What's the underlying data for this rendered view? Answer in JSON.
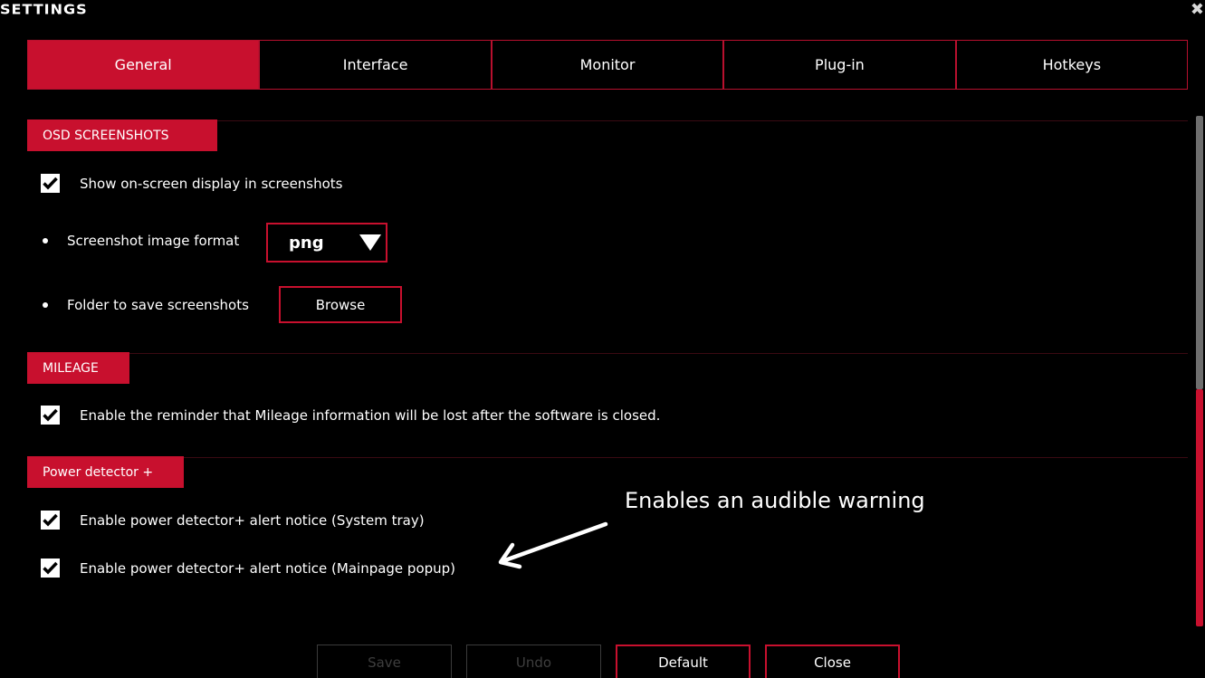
{
  "window": {
    "title": "SETTINGS",
    "close_glyph": "✖"
  },
  "tabs": [
    {
      "label": "General",
      "active": true
    },
    {
      "label": "Interface",
      "active": false
    },
    {
      "label": "Monitor",
      "active": false
    },
    {
      "label": "Plug-in",
      "active": false
    },
    {
      "label": "Hotkeys",
      "active": false
    }
  ],
  "sections": {
    "osd": {
      "title": "OSD SCREENSHOTS",
      "show_osd_label": "Show on-screen display in screenshots",
      "show_osd_checked": true,
      "format_label": "Screenshot image format",
      "format_value": "png",
      "folder_label": "Folder to save screenshots",
      "browse_label": "Browse"
    },
    "mileage": {
      "title": "MILEAGE",
      "reminder_label": "Enable the reminder that Mileage information will be lost after the software is closed.",
      "reminder_checked": true
    },
    "power": {
      "title": "Power detector +",
      "tray_label": "Enable power detector+ alert notice (System tray)",
      "tray_checked": true,
      "popup_label": "Enable power detector+ alert notice (Mainpage popup)",
      "popup_checked": true
    }
  },
  "annotation": {
    "text": "Enables an audible warning"
  },
  "footer": {
    "save_label": "Save",
    "undo_label": "Undo",
    "default_label": "Default",
    "close_label": "Close"
  },
  "colors": {
    "accent": "#c8102e",
    "background": "#000000",
    "disabled_text": "#3e3e3e"
  }
}
